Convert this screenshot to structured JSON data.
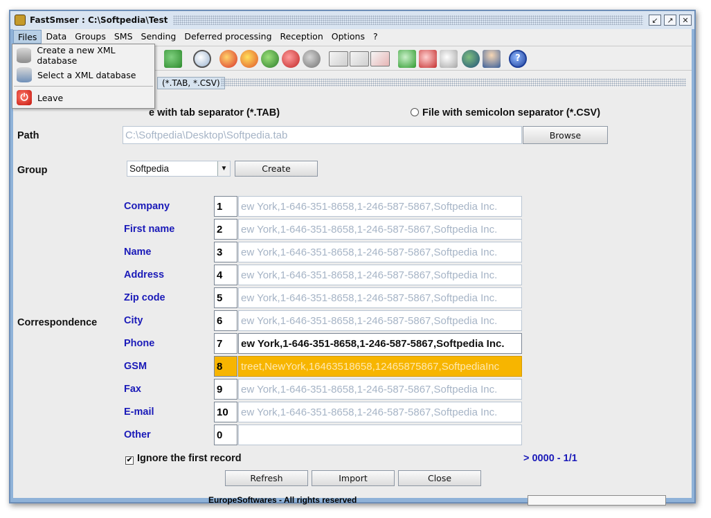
{
  "window": {
    "title": "FastSmser : C:\\Softpedia\\Test",
    "controls": [
      "restore-icon",
      "maximize-icon",
      "close-icon"
    ]
  },
  "menu": [
    "Files",
    "Data",
    "Groups",
    "SMS",
    "Sending",
    "Deferred processing",
    "Reception",
    "Options",
    "?"
  ],
  "files_menu": {
    "items": [
      {
        "label": "Create a new XML database",
        "icon": "database-add-icon"
      },
      {
        "label": "Select a XML database",
        "icon": "database-select-icon"
      },
      {
        "label": "Leave",
        "icon": "power-icon"
      }
    ]
  },
  "tab": {
    "label": "(*.TAB, *.CSV)"
  },
  "form": {
    "radio_tab_label": "e with tab separator (*.TAB)",
    "radio_csv_label": "File with semicolon separator (*.CSV)",
    "path_label": "Path",
    "path_value": "C:\\Softpedia\\Desktop\\Softpedia.tab",
    "browse_label": "Browse",
    "group_label": "Group",
    "group_value": "Softpedia",
    "create_label": "Create",
    "correspondence_label": "Correspondence",
    "fields": [
      {
        "label": "Company",
        "index": "1",
        "value": "ew York,1-646-351-8658,1-246-587-5867,Softpedia Inc."
      },
      {
        "label": "First name",
        "index": "2",
        "value": "ew York,1-646-351-8658,1-246-587-5867,Softpedia Inc."
      },
      {
        "label": "Name",
        "index": "3",
        "value": "ew York,1-646-351-8658,1-246-587-5867,Softpedia Inc."
      },
      {
        "label": "Address",
        "index": "4",
        "value": "ew York,1-646-351-8658,1-246-587-5867,Softpedia Inc."
      },
      {
        "label": "Zip code",
        "index": "5",
        "value": "ew York,1-646-351-8658,1-246-587-5867,Softpedia Inc."
      },
      {
        "label": "City",
        "index": "6",
        "value": "ew York,1-646-351-8658,1-246-587-5867,Softpedia Inc."
      },
      {
        "label": "Phone",
        "index": "7",
        "value": "ew York,1-646-351-8658,1-246-587-5867,Softpedia Inc."
      },
      {
        "label": "GSM",
        "index": "8",
        "value": "treet,NewYork,16463518658,12465875867,SoftpediaInc"
      },
      {
        "label": "Fax",
        "index": "9",
        "value": "ew York,1-646-351-8658,1-246-587-5867,Softpedia Inc."
      },
      {
        "label": "E-mail",
        "index": "10",
        "value": "ew York,1-646-351-8658,1-246-587-5867,Softpedia Inc."
      },
      {
        "label": "Other",
        "index": "0",
        "value": ""
      }
    ],
    "ignore_first_label": "Ignore the first record",
    "ignore_first_checked": "✔",
    "record_counter": "> 0000 - 1/1",
    "refresh_label": "Refresh",
    "import_label": "Import",
    "close_label": "Close"
  },
  "footer": {
    "copyright": "EuropeSoftwares - All rights reserved",
    "progress": 0
  },
  "colors": {
    "highlight": "#f7b500",
    "label_blue": "#1a1ab8",
    "titlebar": "#d9e4f1"
  }
}
